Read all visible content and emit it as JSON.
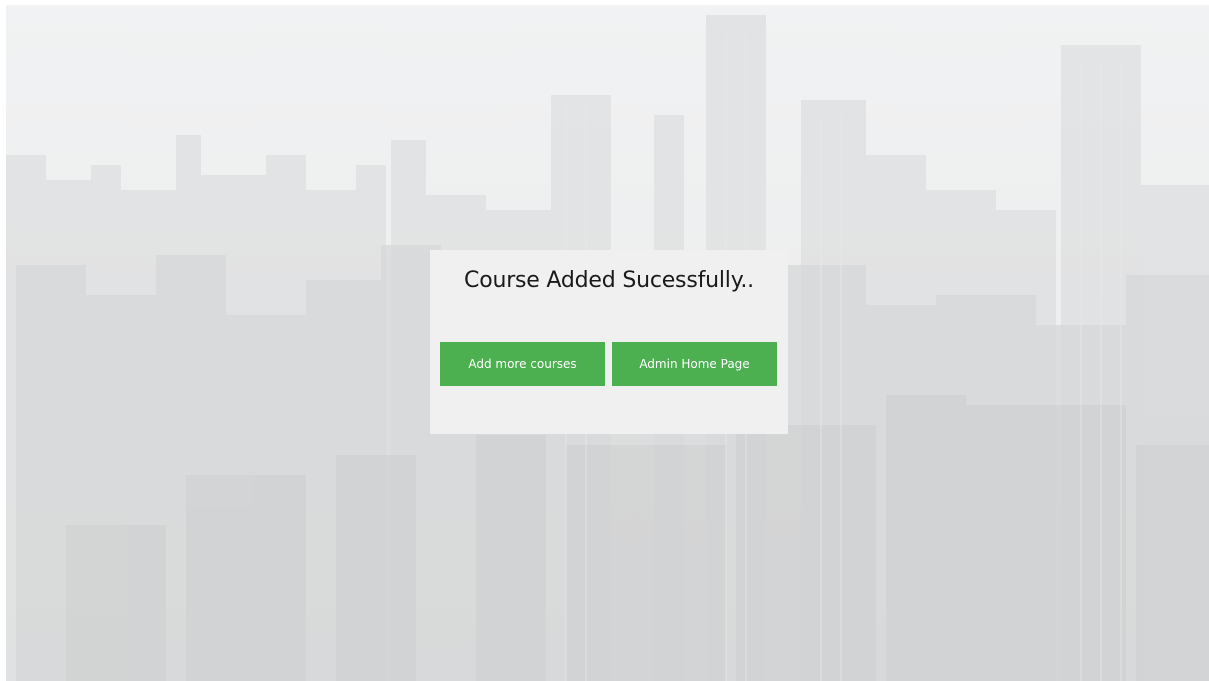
{
  "message": "Course Added Sucessfully..",
  "buttons": {
    "add_more": "Add more courses",
    "admin_home": "Admin Home Page"
  },
  "colors": {
    "button_bg": "#4caf50",
    "button_text": "#ffffff",
    "card_bg": "#f0f0f0"
  }
}
